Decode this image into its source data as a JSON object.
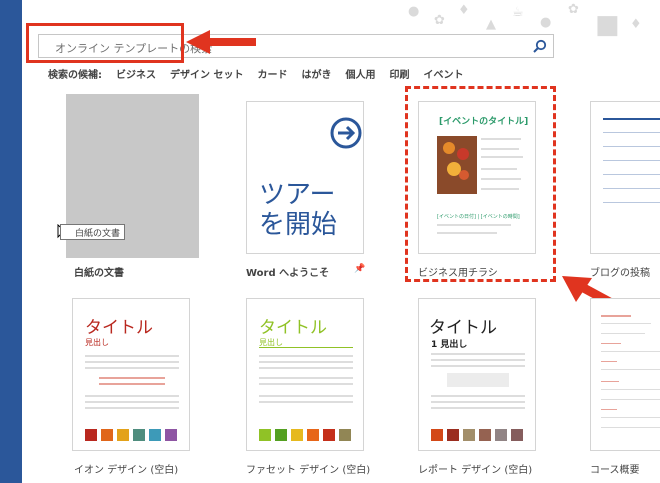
{
  "search": {
    "placeholder": "オンライン テンプレートの検索"
  },
  "suggestions": {
    "label": "検索の候補:",
    "items": [
      "ビジネス",
      "デザイン セット",
      "カード",
      "はがき",
      "個人用",
      "印刷",
      "イベント"
    ]
  },
  "templates": [
    {
      "caption": "白紙の文書"
    },
    {
      "caption": "Word へようこそ",
      "thumb_text": "ツアーを開始"
    },
    {
      "caption": "ビジネス用チラシ",
      "thumb_title": "[イベントのタイトル]",
      "thumb_sub": "[イベントの日付] | [イベントの時間]"
    },
    {
      "caption": "ブログの投稿"
    },
    {
      "caption": "イオン デザイン (空白)",
      "thumb_title": "タイトル",
      "thumb_sub": "見出し"
    },
    {
      "caption": "ファセット デザイン (空白)",
      "thumb_title": "タイトル",
      "thumb_sub": "見出し"
    },
    {
      "caption": "レポート デザイン (空白)",
      "thumb_title": "タイトル",
      "thumb_sub": "1 見出し"
    },
    {
      "caption": "コース概要"
    }
  ],
  "tooltip": "白紙の文書",
  "colors": {
    "accent": "#2b579a",
    "highlight": "#e0341f",
    "ion": "#b9281f",
    "facet": "#90c226",
    "flyer": "#2b9a6a"
  },
  "swatches": {
    "ion": [
      "#b9281f",
      "#e0661a",
      "#e3a21a",
      "#4f8d7e",
      "#3d9ab8",
      "#8e55a3"
    ],
    "facet": [
      "#90c226",
      "#54a021",
      "#e6b91e",
      "#e76618",
      "#c42f1a",
      "#918655"
    ],
    "report": [
      "#d34817",
      "#9b2d1f",
      "#a28e6a",
      "#956251",
      "#918485",
      "#855d5d"
    ]
  }
}
